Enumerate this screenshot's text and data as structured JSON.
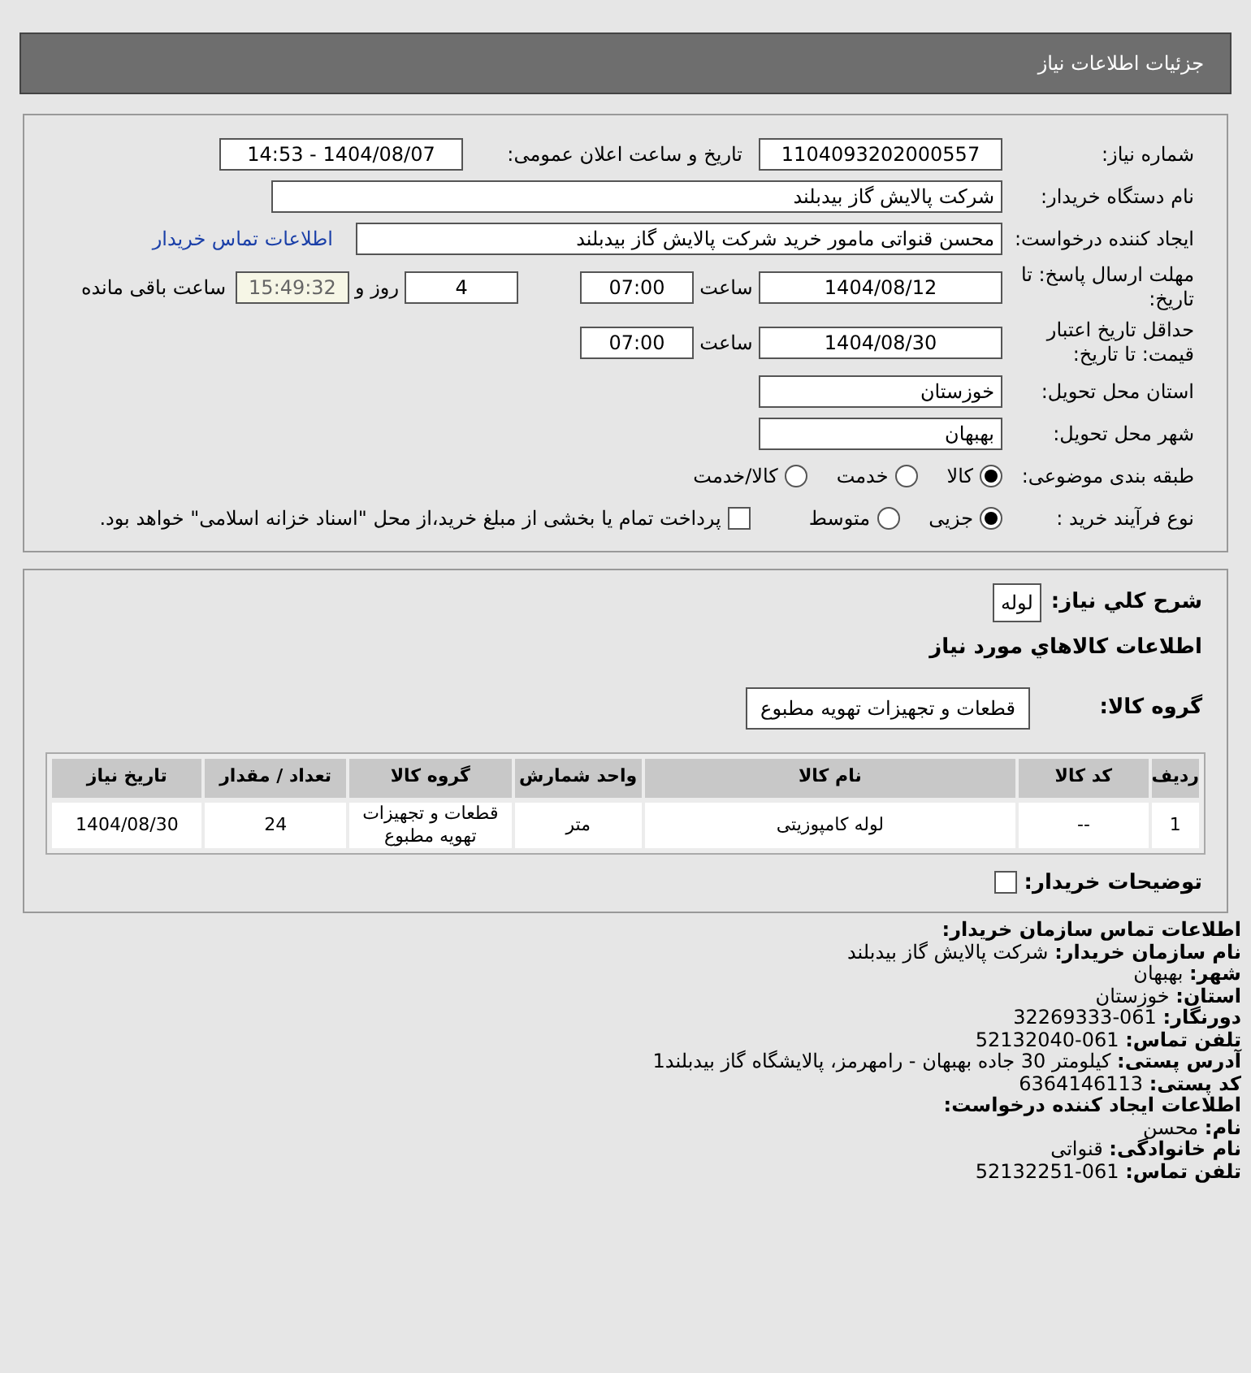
{
  "header": {
    "title": "جزئیات اطلاعات نیاز"
  },
  "need_number": {
    "label": "شماره نیاز:",
    "value": "1104093202000557"
  },
  "announce": {
    "label": "تاریخ و ساعت اعلان عمومی:",
    "value": "1404/08/07 - 14:53"
  },
  "buyer": {
    "label": "نام دستگاه خریدار:",
    "value": "شرکت پالایش گاز بیدبلند"
  },
  "requester": {
    "label": "ایجاد کننده درخواست:",
    "value": "محسن قنواتی مامور خرید شرکت پالایش گاز بیدبلند",
    "link": "اطلاعات تماس خریدار"
  },
  "deadline": {
    "label": "مهلت ارسال پاسخ: تا تاریخ:",
    "date": "1404/08/12",
    "time_label": "ساعت",
    "time": "07:00",
    "days": "4",
    "days_label": "روز و",
    "remaining": "15:49:32",
    "remaining_label": "ساعت باقی مانده"
  },
  "validity": {
    "label": "حداقل تاریخ اعتبار قیمت: تا تاریخ:",
    "date": "1404/08/30",
    "time_label": "ساعت",
    "time": "07:00"
  },
  "province": {
    "label": "استان محل تحویل:",
    "value": "خوزستان"
  },
  "city": {
    "label": "شهر محل تحویل:",
    "value": "بهبهان"
  },
  "category": {
    "label": "طبقه بندی موضوعی:",
    "options": [
      {
        "label": "کالا",
        "selected": true
      },
      {
        "label": "خدمت",
        "selected": false
      },
      {
        "label": "کالا/خدمت",
        "selected": false
      }
    ]
  },
  "process": {
    "label": "نوع فرآیند خرید :",
    "options": [
      {
        "label": "جزیی",
        "selected": true
      },
      {
        "label": "متوسط",
        "selected": false
      }
    ],
    "payment": {
      "label": "پرداخت تمام یا بخشی از مبلغ خرید،از محل \"اسناد خزانه اسلامی\" خواهد بود.",
      "checked": false
    }
  },
  "summary": {
    "label": "شرح کلي نياز:",
    "value": "لوله"
  },
  "goods_title": "اطلاعات كالاهاي مورد نياز",
  "goods_group": {
    "label": "گروه کالا:",
    "value": "قطعات و تجهیزات تهویه مطبوع"
  },
  "table": {
    "columns": [
      "ردیف",
      "کد کالا",
      "نام کالا",
      "واحد شمارش",
      "گروه کالا",
      "تعداد / مقدار",
      "تاریخ نیاز"
    ],
    "rows": [
      [
        "1",
        "--",
        "لوله کامپوزیتی",
        "متر",
        "قطعات و تجهیزات تهویه مطبوع",
        "24",
        "1404/08/30"
      ]
    ]
  },
  "buyer_notes": {
    "label": "توضیحات خریدار:",
    "checked": false
  },
  "contact": [
    {
      "kind": "heading",
      "label": "اطلاعات تماس سازمان خریدار:"
    },
    {
      "kind": "field",
      "label": "نام سازمان خریدار:",
      "value": "شرکت پالایش گاز بیدبلند"
    },
    {
      "kind": "field",
      "label": "شهر:",
      "value": "بهبهان"
    },
    {
      "kind": "field",
      "label": "استان:",
      "value": "خوزستان"
    },
    {
      "kind": "field",
      "label": "دورنگار:",
      "value": "061-32269333"
    },
    {
      "kind": "field",
      "label": "تلفن تماس:",
      "value": "061-52132040"
    },
    {
      "kind": "field",
      "label": "آدرس پستی:",
      "value": "کیلومتر 30 جاده بهبهان - رامهرمز، پالایشگاه گاز بیدبلند1"
    },
    {
      "kind": "field",
      "label": "کد پستی:",
      "value": "6364146113"
    },
    {
      "kind": "heading",
      "label": "اطلاعات ایجاد کننده درخواست:"
    },
    {
      "kind": "field",
      "label": "نام:",
      "value": "محسن"
    },
    {
      "kind": "field",
      "label": "نام خانوادگی:",
      "value": "قنواتی"
    },
    {
      "kind": "field",
      "label": "تلفن تماس:",
      "value": "061-52132251"
    }
  ]
}
